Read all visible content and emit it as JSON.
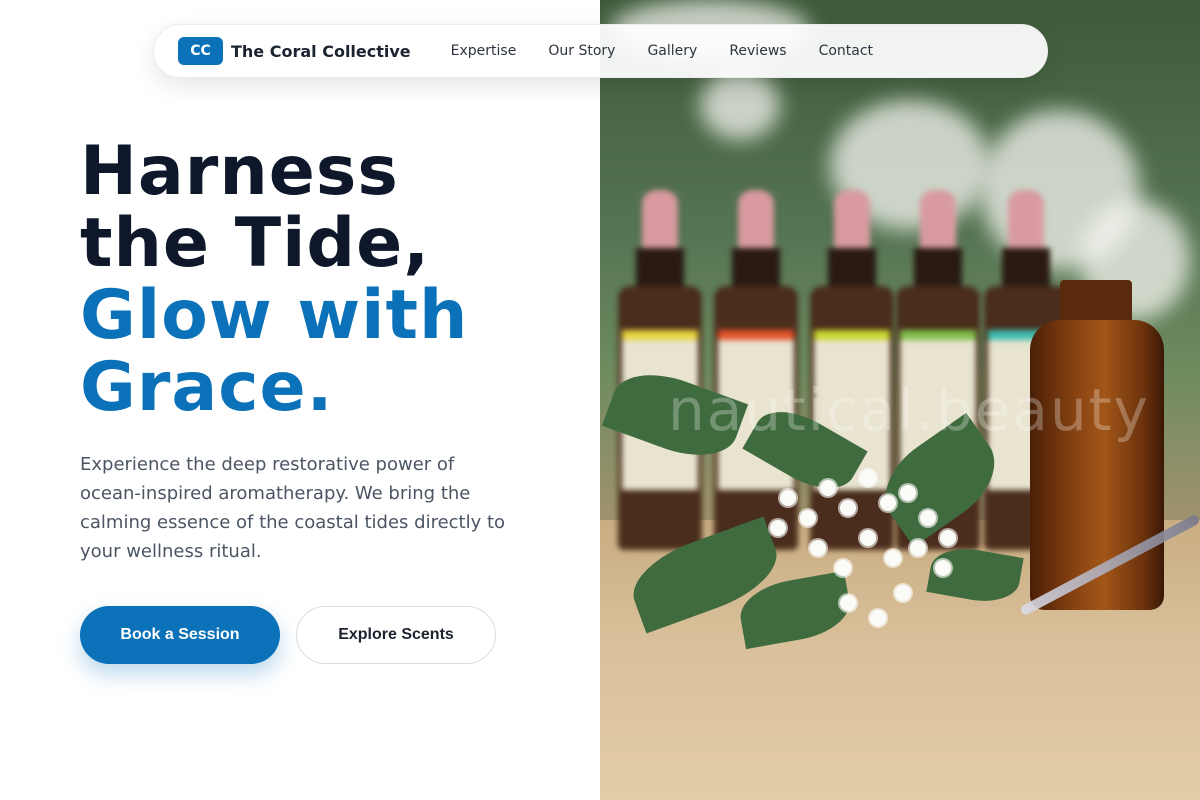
{
  "nav": {
    "logo_text": "CC",
    "brand": "The Coral Collective",
    "links": [
      "Expertise",
      "Our Story",
      "Gallery",
      "Reviews",
      "Contact"
    ]
  },
  "hero": {
    "headline_dark_1": "Harness",
    "headline_dark_2": "the Tide,",
    "headline_accent_1": "Glow with",
    "headline_accent_2": "Grace.",
    "description": "Experience the deep restorative power of ocean-inspired aromatherapy. We bring the calming essence of the coastal tides directly to your wellness ritual.",
    "primary_cta": "Book a Session",
    "secondary_cta": "Explore Scents"
  },
  "image": {
    "watermark": "nautical.beauty",
    "subject": "essential-oil-bottles-with-white-flowers"
  },
  "colors": {
    "accent": "#0b72b9",
    "heading": "#0f172a",
    "body_text": "#4b5563"
  }
}
